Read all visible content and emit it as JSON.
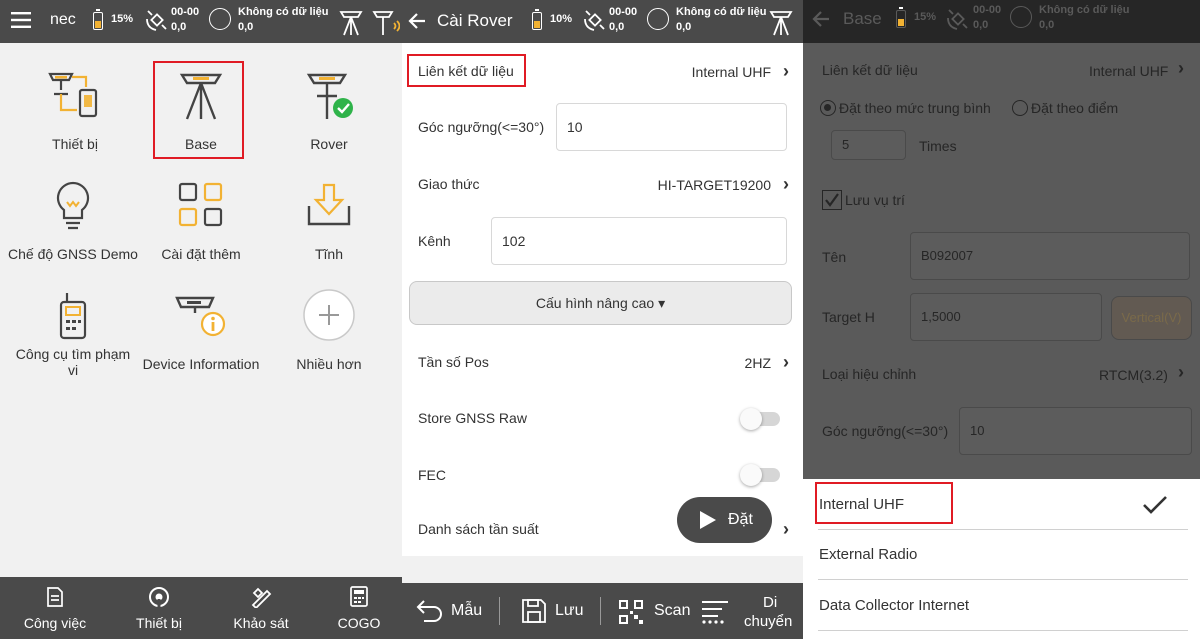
{
  "panel1": {
    "status": {
      "app_fragment": "nec",
      "battery": "15%",
      "sats_top": "00-00",
      "sats_bottom": "0,0",
      "data_top": "Không có dữ liệu",
      "data_bottom": "0,0"
    },
    "grid": [
      {
        "label": "Thiết bị",
        "icon": "device-connect-icon"
      },
      {
        "label": "Base",
        "icon": "base-station-icon"
      },
      {
        "label": "Rover",
        "icon": "rover-icon"
      },
      {
        "label": "Chế độ GNSS Demo",
        "icon": "lightbulb-icon"
      },
      {
        "label": "Cài đặt thêm",
        "icon": "apps-grid-icon"
      },
      {
        "label": "Tĩnh",
        "icon": "download-tray-icon"
      },
      {
        "label": "Công cụ tìm phạm vi",
        "icon": "radio-device-icon"
      },
      {
        "label": "Device Information",
        "icon": "device-info-icon"
      },
      {
        "label": "Nhiều hơn",
        "icon": "plus-circle-icon"
      }
    ],
    "bottom_nav": [
      {
        "label": "Công việc",
        "icon": "document-icon"
      },
      {
        "label": "Thiết bị",
        "icon": "antenna-icon"
      },
      {
        "label": "Khảo sát",
        "icon": "survey-icon"
      },
      {
        "label": "COGO",
        "icon": "calculator-icon"
      }
    ]
  },
  "panel2": {
    "title": "Cài Rover",
    "status": {
      "battery": "10%",
      "sats_top": "00-00",
      "sats_bottom": "0,0",
      "data_top": "Không có dữ liệu",
      "data_bottom": "0,0"
    },
    "data_link": {
      "label": "Liên kết dữ liệu",
      "value": "Internal UHF"
    },
    "elevation": {
      "label": "Góc ngưỡng(<=30°)",
      "value": "10"
    },
    "protocol": {
      "label": "Giao thức",
      "value": "HI-TARGET19200"
    },
    "channel": {
      "label": "Kênh",
      "value": "102"
    },
    "advanced_button": "Cấu hình nâng cao ▾",
    "pos_freq": {
      "label": "Tần số Pos",
      "value": "2HZ"
    },
    "store_raw": {
      "label": "Store GNSS Raw"
    },
    "fec": {
      "label": "FEC"
    },
    "freq_list": {
      "label": "Danh sách tần suất"
    },
    "set_button": "Đặt",
    "toolbar": {
      "template": "Mẫu",
      "save": "Lưu",
      "scan": "Scan",
      "move_top": "Di",
      "move_bottom": "chuyển"
    }
  },
  "panel3": {
    "title": "Base",
    "status": {
      "battery": "15%",
      "sats_top": "00-00",
      "sats_bottom": "0,0",
      "data_top": "Không có dữ liệu",
      "data_bottom": "0,0"
    },
    "data_link": {
      "label": "Liên kết dữ liệu",
      "value": "Internal UHF"
    },
    "radio_avg": "Đặt theo mức trung bình",
    "radio_point": "Đặt theo điểm",
    "times_value": "5",
    "times_label": "Times",
    "save_position": "Lưu vụ trí",
    "name": {
      "label": "Tên",
      "value": "B092007"
    },
    "target_h": {
      "label": "Target H",
      "value": "1,5000",
      "mode": "Vertical(V)"
    },
    "correction": {
      "label": "Loại hiệu chỉnh",
      "value": "RTCM(3.2)"
    },
    "elevation": {
      "label": "Góc ngưỡng(<=30°)",
      "value": "10"
    },
    "options": [
      "Internal UHF",
      "External Radio",
      "Data Collector Internet"
    ],
    "selected_index": 0
  },
  "colors": {
    "bar": "#4a4a4a",
    "accent_yellow": "#f2b233",
    "highlight_red": "#e01b24",
    "check_green": "#2fb34a"
  }
}
